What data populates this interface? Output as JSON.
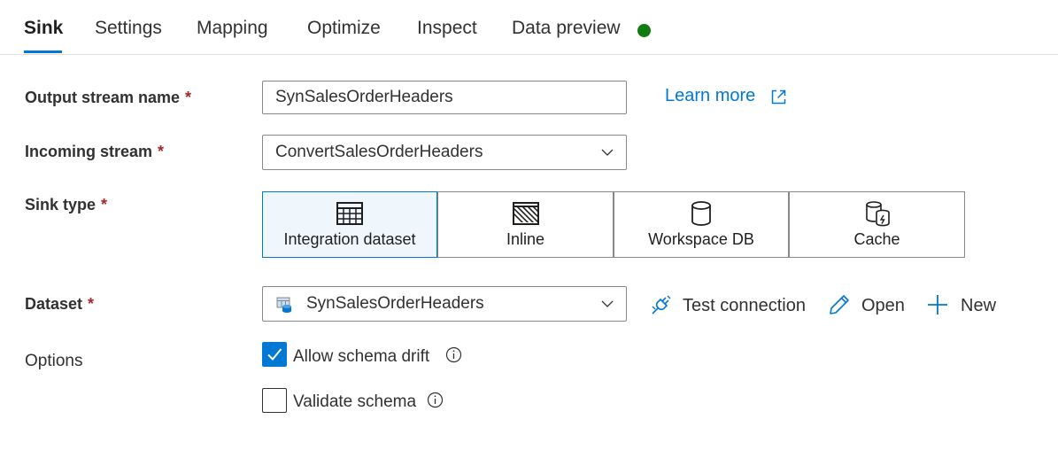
{
  "tabs": [
    {
      "label": "Sink",
      "active": true
    },
    {
      "label": "Settings",
      "active": false
    },
    {
      "label": "Mapping",
      "active": false
    },
    {
      "label": "Optimize",
      "active": false
    },
    {
      "label": "Inspect",
      "active": false
    },
    {
      "label": "Data preview",
      "active": false
    }
  ],
  "status_color": "#107c10",
  "required_marker": "*",
  "output_stream": {
    "label": "Output stream name",
    "value": "SynSalesOrderHeaders"
  },
  "learn_more": {
    "label": "Learn more",
    "icon": "external-link-icon"
  },
  "incoming_stream": {
    "label": "Incoming stream",
    "value": "ConvertSalesOrderHeaders",
    "icon": "chevron-down-icon"
  },
  "sink_type": {
    "label": "Sink type",
    "options": [
      {
        "label": "Integration dataset",
        "icon": "table-icon",
        "selected": true
      },
      {
        "label": "Inline",
        "icon": "inline-hatch-icon",
        "selected": false
      },
      {
        "label": "Workspace DB",
        "icon": "database-icon",
        "selected": false
      },
      {
        "label": "Cache",
        "icon": "cache-icon",
        "selected": false
      }
    ]
  },
  "dataset": {
    "label": "Dataset",
    "value": "SynSalesOrderHeaders",
    "icon": "dataset-icon"
  },
  "actions": {
    "test_connection": "Test connection",
    "open": "Open",
    "new": "New"
  },
  "options": {
    "label": "Options",
    "allow_schema_drift": {
      "label": "Allow schema drift",
      "checked": true
    },
    "validate_schema": {
      "label": "Validate schema",
      "checked": false
    }
  },
  "colors": {
    "accent": "#0078d4",
    "required": "#a4262c",
    "selected_bg": "#eff6fc"
  }
}
